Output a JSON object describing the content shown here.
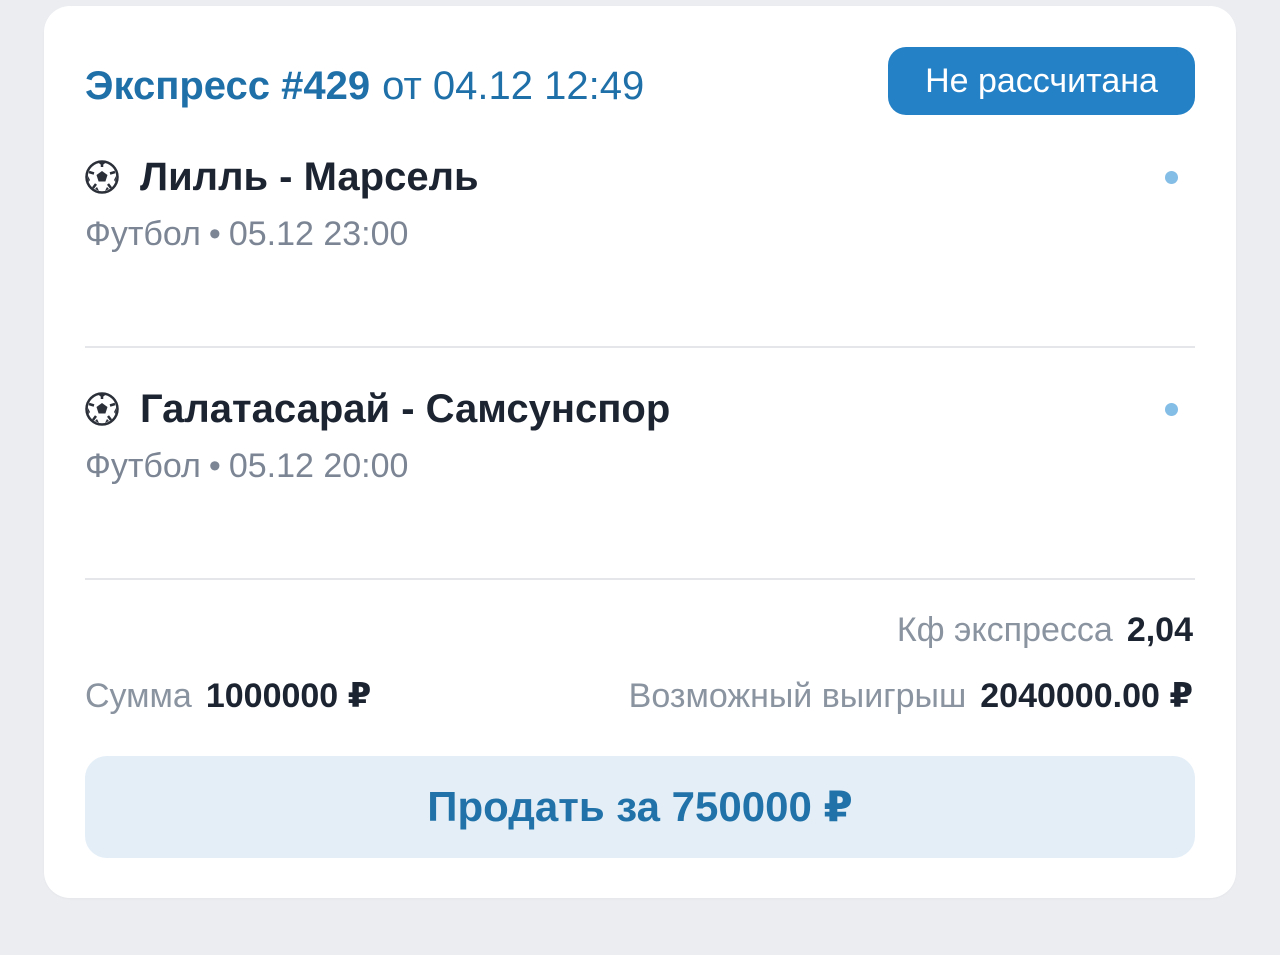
{
  "bet": {
    "title_prefix": "Экспресс #429",
    "title_date": "от 04.12 12:49",
    "status": "Не рассчитана"
  },
  "events": [
    {
      "icon": "soccer-ball-icon",
      "title": "Лилль - Марсель",
      "sport": "Футбол",
      "separator": "•",
      "datetime": "05.12 23:00"
    },
    {
      "icon": "soccer-ball-icon",
      "title": "Галатасарай - Самсунспор",
      "sport": "Футбол",
      "separator": "•",
      "datetime": "05.12 20:00"
    }
  ],
  "summary": {
    "coef_label": "Кф экспресса",
    "coef_value": "2,04",
    "sum_label": "Сумма",
    "sum_value": "1000000 ₽",
    "win_label": "Возможный выигрыш",
    "win_value": "2040000.00 ₽"
  },
  "actions": {
    "sell_label": "Продать за 750000 ₽"
  },
  "colors": {
    "accent": "#2481c6",
    "title_blue": "#1f6fa9",
    "button_bg": "#e3eef7",
    "dot": "#84bde6"
  }
}
